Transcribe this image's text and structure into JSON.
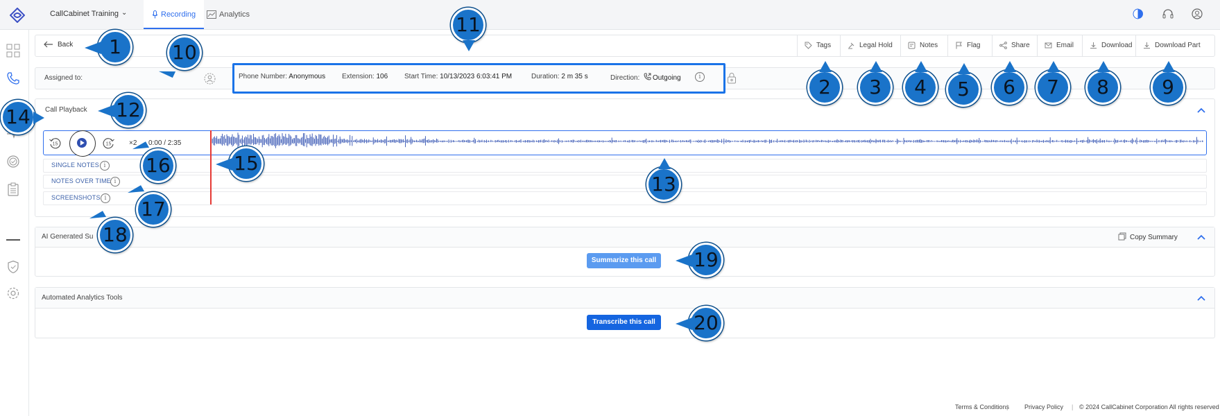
{
  "header": {
    "org_name": "CallCabinet Training",
    "tabs": [
      {
        "label": "Recording"
      },
      {
        "label": "Analytics"
      }
    ]
  },
  "toolbar": {
    "back_label": "Back",
    "buttons": [
      {
        "label": "Tags",
        "icon": "tag-icon"
      },
      {
        "label": "Legal Hold",
        "icon": "gavel-icon"
      },
      {
        "label": "Notes",
        "icon": "notes-icon"
      },
      {
        "label": "Flag",
        "icon": "flag-icon"
      },
      {
        "label": "Share",
        "icon": "share-icon"
      },
      {
        "label": "Email",
        "icon": "email-icon"
      },
      {
        "label": "Download",
        "icon": "download-icon"
      },
      {
        "label": "Download Part",
        "icon": "download-icon"
      }
    ]
  },
  "info": {
    "assigned_label": "Assigned to:",
    "phone_label": "Phone Number:",
    "phone_value": "Anonymous",
    "ext_label": "Extension:",
    "ext_value": "106",
    "start_label": "Start Time:",
    "start_value": "10/13/2023 6:03:41 PM",
    "duration_label": "Duration:",
    "duration_value": "2 m 35 s",
    "direction_label": "Direction:",
    "direction_value": "Outgoing"
  },
  "playback": {
    "title": "Call Playback",
    "skip_back": "15",
    "skip_forward": "15",
    "speed": "×2",
    "time": "0:00 / 2:35",
    "progress": 0,
    "rows": [
      {
        "label": "SINGLE NOTES"
      },
      {
        "label": "NOTES OVER TIME"
      },
      {
        "label": "SCREENSHOTS"
      }
    ]
  },
  "ai_summary": {
    "title": "AI Generated Su",
    "copy_label": "Copy Summary",
    "button_label": "Summarize this call"
  },
  "analytics_tools": {
    "title": "Automated Analytics Tools",
    "button_label": "Transcribe this call"
  },
  "footer": {
    "terms": "Terms & Conditions",
    "privacy": "Privacy Policy",
    "copyright": "© 2024 CallCabinet Corporation All rights reserved"
  },
  "callouts": [
    "1",
    "2",
    "3",
    "4",
    "5",
    "6",
    "7",
    "8",
    "9",
    "10",
    "11",
    "12",
    "13",
    "14",
    "15",
    "16",
    "17",
    "18",
    "19",
    "20"
  ],
  "colors": {
    "accent": "#2f6fed",
    "callout": "#1a73c9",
    "playhead": "#e53935",
    "highlight": "#1a73e8"
  }
}
